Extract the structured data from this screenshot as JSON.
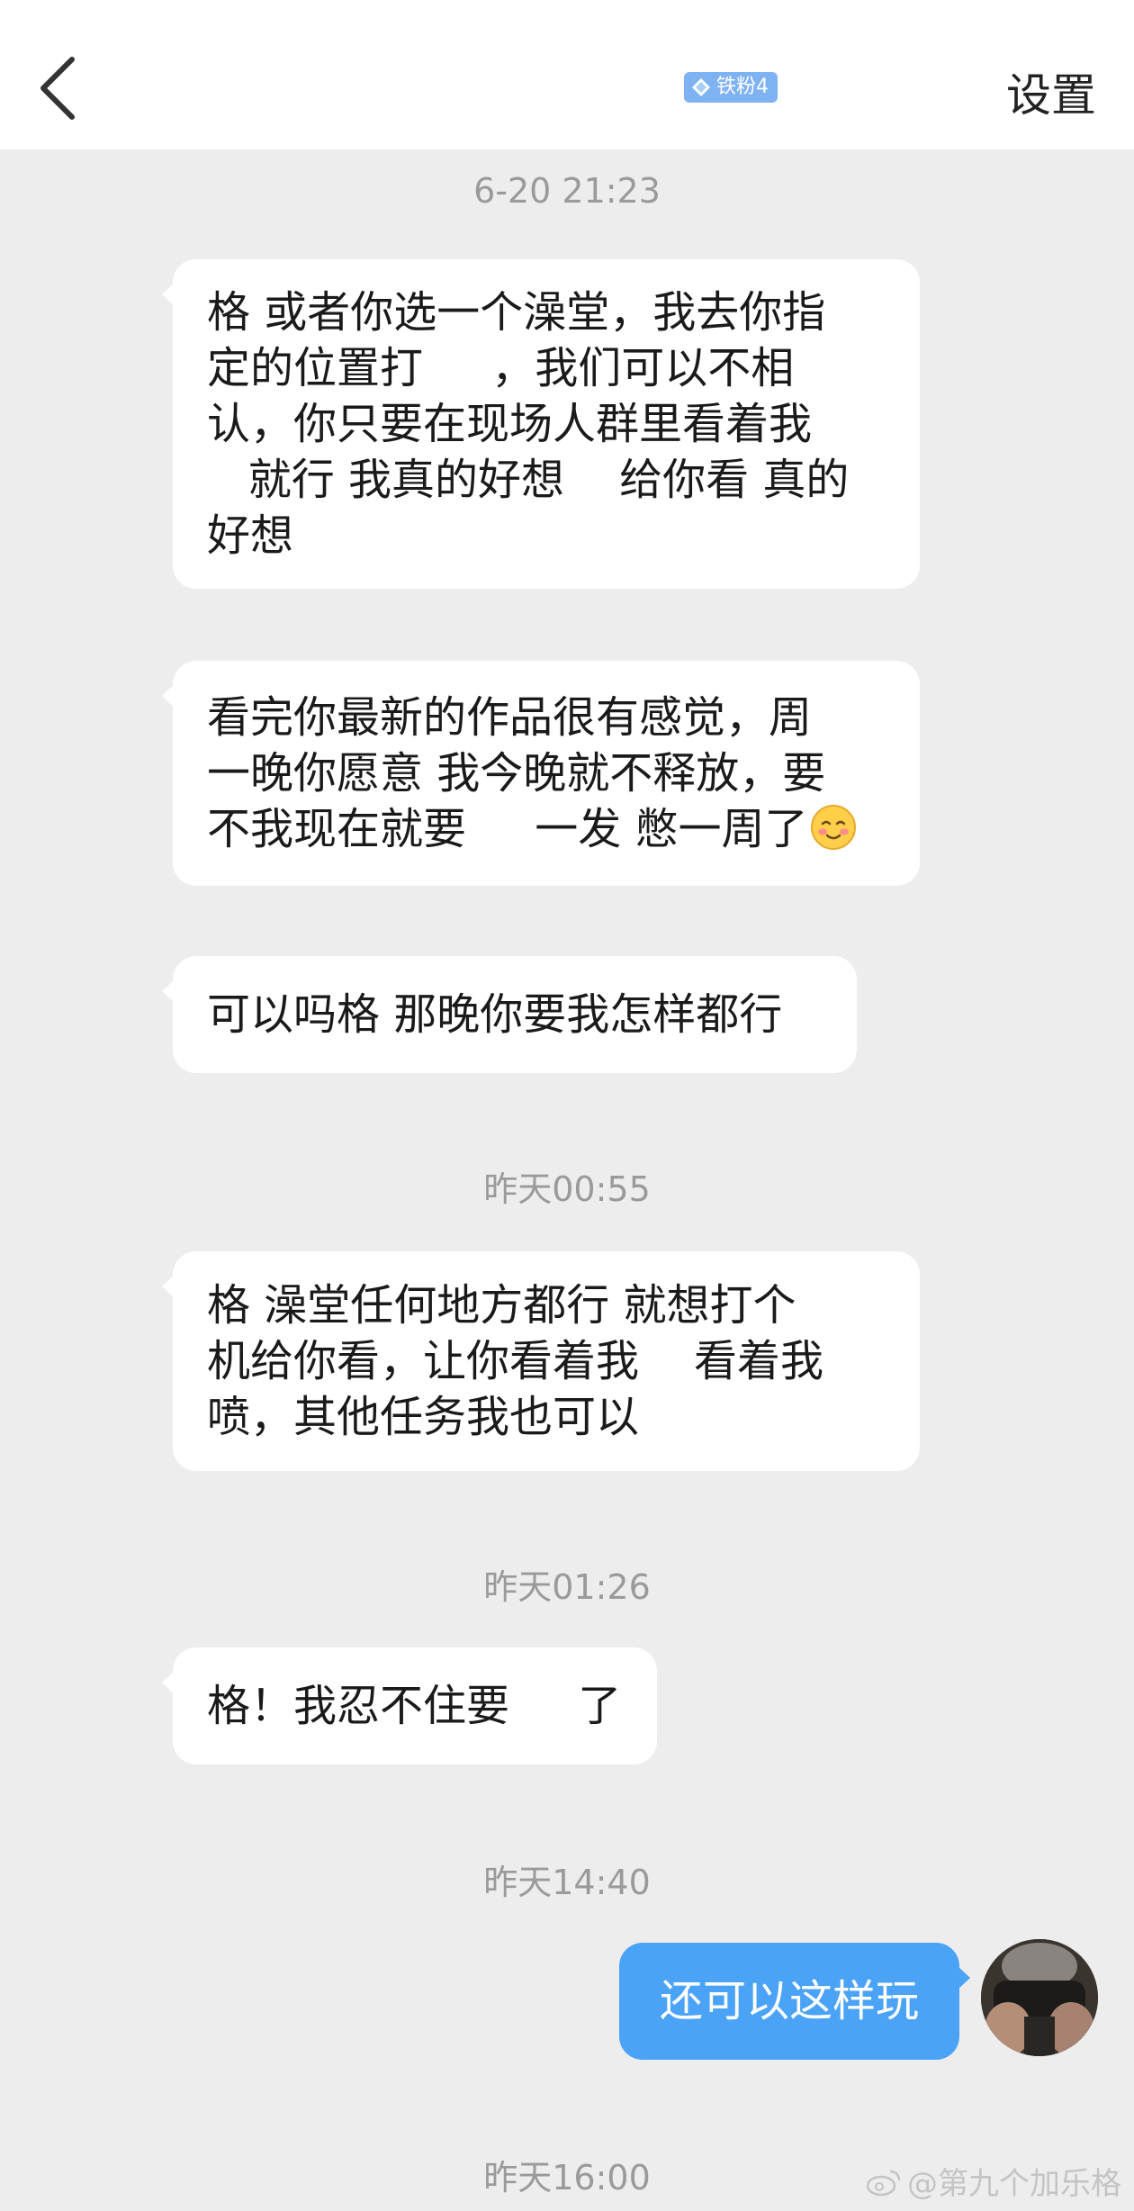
{
  "header": {
    "back_icon": "chevron-left-icon",
    "badge_icon": "diamond-icon",
    "badge_label": "铁粉4",
    "settings_label": "设置"
  },
  "colors": {
    "header_bg": "#ffffff",
    "chat_bg": "#ededed",
    "incoming_bubble": "#ffffff",
    "outgoing_bubble": "#4aa3f6",
    "badge_bg": "#7fb2f2",
    "timestamp": "#9a9a9a"
  },
  "messages": {
    "ts1": "6-20 21:23",
    "m1": "格 或者你选一个澡堂，我去你指\n定的位置打     ，我们可以不相\n认，你只要在现场人群里看着我\n   就行 我真的好想    给你看 真的\n好想",
    "m2": "看完你最新的作品很有感觉，周\n一晚你愿意 我今晚就不释放，要\n不我现在就要     一发 憋一周了",
    "m2_emoji": "smiling-face-with-hearts-emoji",
    "m3": "可以吗格 那晚你要我怎样都行",
    "ts2": "昨天00:55",
    "m4": "格 澡堂任何地方都行 就想打个\n机给你看，让你看着我    看着我\n喷，其他任务我也可以",
    "ts3": "昨天01:26",
    "m5": "格！我忍不住要     了",
    "ts4": "昨天14:40",
    "m6": "还可以这样玩",
    "ts5": "昨天16:00"
  },
  "watermark": {
    "icon": "weibo-icon",
    "text": "@第九个加乐格"
  }
}
